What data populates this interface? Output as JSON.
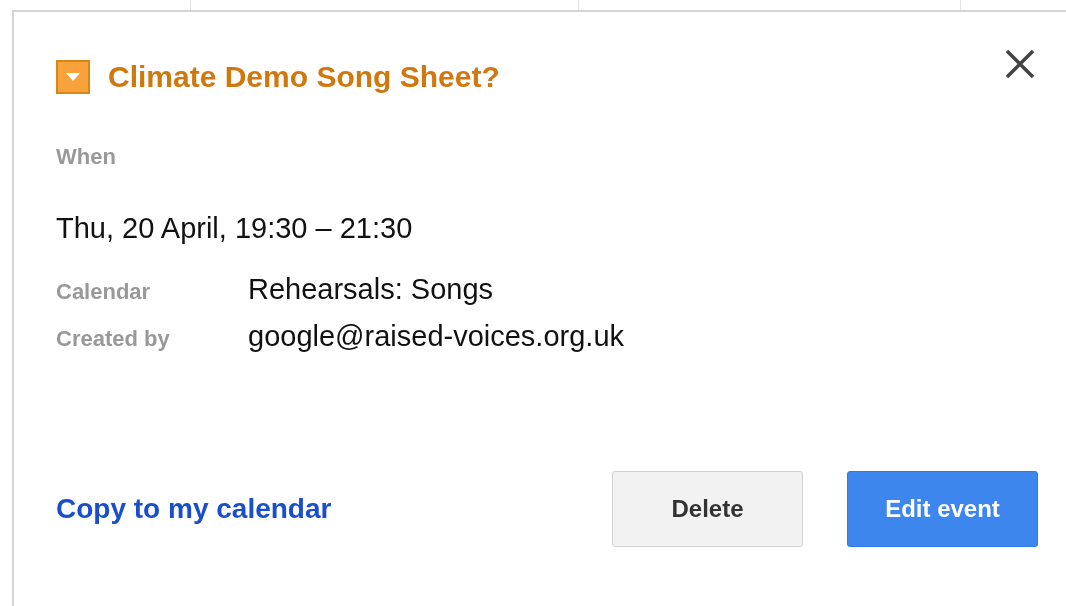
{
  "event": {
    "title": "Climate Demo Song Sheet?"
  },
  "when_label": "When",
  "when": "Thu, 20 April, 19:30 – 21:30",
  "details": [
    {
      "label": "Calendar",
      "value": "Rehearsals: Songs"
    },
    {
      "label": "Created by",
      "value": "google@raised-voices.org.uk"
    }
  ],
  "link": "Copy to my calendar",
  "buttons": [
    {
      "label": "Delete",
      "kind": "secondary"
    },
    {
      "label": "Edit event",
      "kind": "primary"
    }
  ]
}
